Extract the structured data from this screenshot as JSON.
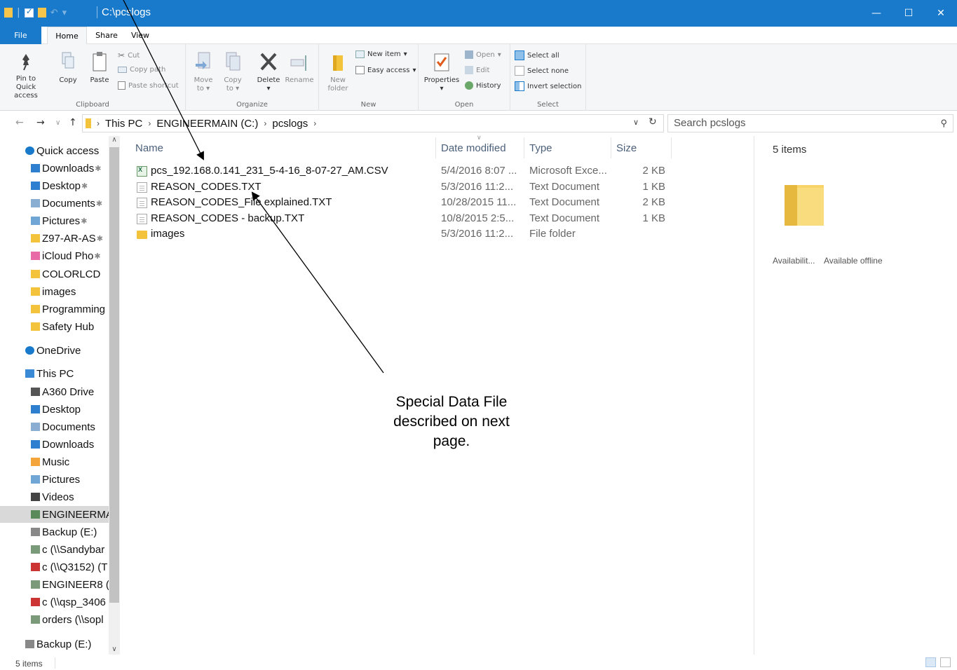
{
  "titlebar": {
    "title": "C:\\pcslogs",
    "minimize_glyph": "—",
    "maximize_glyph": "☐",
    "close_glyph": "✕"
  },
  "ribbon_tabs": [
    "File",
    "Home",
    "Share",
    "View"
  ],
  "ribbon": {
    "clipboard": {
      "pin_label": "Pin to Quick access",
      "copy_label": "Copy",
      "paste_label": "Paste",
      "cut_label": "Cut",
      "copy_path_label": "Copy path",
      "paste_shortcut_label": "Paste shortcut",
      "group_label": "Clipboard"
    },
    "organize": {
      "move_to_label": "Move to",
      "copy_to_label": "Copy to",
      "delete_label": "Delete",
      "rename_label": "Rename",
      "group_label": "Organize"
    },
    "new": {
      "new_folder_label": "New folder",
      "new_item_label": "New item",
      "easy_access_label": "Easy access",
      "group_label": "New"
    },
    "open": {
      "properties_label": "Properties",
      "open_label": "Open",
      "edit_label": "Edit",
      "history_label": "History",
      "group_label": "Open"
    },
    "select": {
      "select_all_label": "Select all",
      "select_none_label": "Select none",
      "invert_selection_label": "Invert selection",
      "group_label": "Select"
    }
  },
  "address": {
    "crumbs": [
      "This PC",
      "ENGINEERMAIN (C:)",
      "pcslogs"
    ],
    "search_placeholder": "Search pcslogs"
  },
  "nav_pane": {
    "items": [
      {
        "label": "Quick access",
        "icon": "star-icon",
        "color": "#1979ca",
        "pinned": false
      },
      {
        "label": "Downloads",
        "icon": "downloads-icon",
        "color": "#2f7fd0",
        "pinned": true
      },
      {
        "label": "Desktop",
        "icon": "desktop-icon",
        "color": "#2f7fd0",
        "pinned": true
      },
      {
        "label": "Documents",
        "icon": "documents-icon",
        "color": "#8aaed2",
        "pinned": true
      },
      {
        "label": "Pictures",
        "icon": "pictures-icon",
        "color": "#6fa6d6",
        "pinned": true
      },
      {
        "label": "Z97-AR-AS",
        "icon": "folder-icon",
        "color": "#f3c33c",
        "pinned": true
      },
      {
        "label": "iCloud Pho",
        "icon": "icloud-photos-icon",
        "color": "#e86aa6",
        "pinned": true
      },
      {
        "label": "COLORLCD",
        "icon": "folder-icon",
        "color": "#f3c33c",
        "pinned": false
      },
      {
        "label": "images",
        "icon": "folder-icon",
        "color": "#f3c33c",
        "pinned": false
      },
      {
        "label": "Programming",
        "icon": "folder-icon",
        "color": "#f3c33c",
        "pinned": false
      },
      {
        "label": "Safety Hub",
        "icon": "folder-icon",
        "color": "#f3c33c",
        "pinned": false
      },
      {
        "label": "OneDrive",
        "icon": "onedrive-icon",
        "color": "#1979ca",
        "pinned": false
      },
      {
        "label": "This PC",
        "icon": "this-pc-icon",
        "color": "#3a8ad6",
        "pinned": false
      },
      {
        "label": "A360 Drive",
        "icon": "a360-drive-icon",
        "color": "#555555",
        "pinned": false
      },
      {
        "label": "Desktop",
        "icon": "desktop-icon",
        "color": "#2f7fd0",
        "pinned": false
      },
      {
        "label": "Documents",
        "icon": "documents-icon",
        "color": "#8aaed2",
        "pinned": false
      },
      {
        "label": "Downloads",
        "icon": "downloads-icon",
        "color": "#2f7fd0",
        "pinned": false
      },
      {
        "label": "Music",
        "icon": "music-icon",
        "color": "#f3a53c",
        "pinned": false
      },
      {
        "label": "Pictures",
        "icon": "pictures-icon",
        "color": "#6fa6d6",
        "pinned": false
      },
      {
        "label": "Videos",
        "icon": "videos-icon",
        "color": "#444444",
        "pinned": false
      },
      {
        "label": "ENGINEERMA",
        "icon": "drive-icon",
        "color": "#5a8a5a",
        "pinned": false,
        "selected": true
      },
      {
        "label": "Backup (E:)",
        "icon": "drive-icon",
        "color": "#888888",
        "pinned": false
      },
      {
        "label": "c (\\\\Sandybar",
        "icon": "network-drive-icon",
        "color": "#7a9a7a",
        "pinned": false
      },
      {
        "label": "c (\\\\Q3152) (T",
        "icon": "network-drive-disconnected-icon",
        "color": "#cc3333",
        "pinned": false
      },
      {
        "label": "ENGINEER8 (\\",
        "icon": "network-drive-icon",
        "color": "#7a9a7a",
        "pinned": false
      },
      {
        "label": "c (\\\\qsp_3406",
        "icon": "network-drive-disconnected-icon",
        "color": "#cc3333",
        "pinned": false
      },
      {
        "label": "orders (\\\\sopl",
        "icon": "network-drive-icon",
        "color": "#7a9a7a",
        "pinned": false
      },
      {
        "label": "Backup (E:)",
        "icon": "drive-icon",
        "color": "#888888",
        "pinned": false
      }
    ]
  },
  "columns": {
    "name": "Name",
    "date": "Date modified",
    "type": "Type",
    "size": "Size"
  },
  "files": [
    {
      "name": "pcs_192.168.0.141_231_5-4-16_8-07-27_AM.CSV",
      "date": "5/4/2016 8:07 ...",
      "type": "Microsoft Exce...",
      "size": "2 KB",
      "icon": "csv"
    },
    {
      "name": "REASON_CODES.TXT",
      "date": "5/3/2016 11:2...",
      "type": "Text Document",
      "size": "1 KB",
      "icon": "doc"
    },
    {
      "name": "REASON_CODES_File explained.TXT",
      "date": "10/28/2015 11...",
      "type": "Text Document",
      "size": "2 KB",
      "icon": "doc"
    },
    {
      "name": "REASON_CODES - backup.TXT",
      "date": "10/8/2015 2:5...",
      "type": "Text Document",
      "size": "1 KB",
      "icon": "doc"
    },
    {
      "name": "images",
      "date": "5/3/2016 11:2...",
      "type": "File folder",
      "size": "",
      "icon": "fold"
    }
  ],
  "details_pane": {
    "item_count": "5 items",
    "availability_label": "Availabilit...",
    "availability_value": "Available offline"
  },
  "status_bar": {
    "text": "5 items"
  },
  "annotation": {
    "lines": [
      "Special Data File",
      "described on next",
      "page."
    ]
  }
}
